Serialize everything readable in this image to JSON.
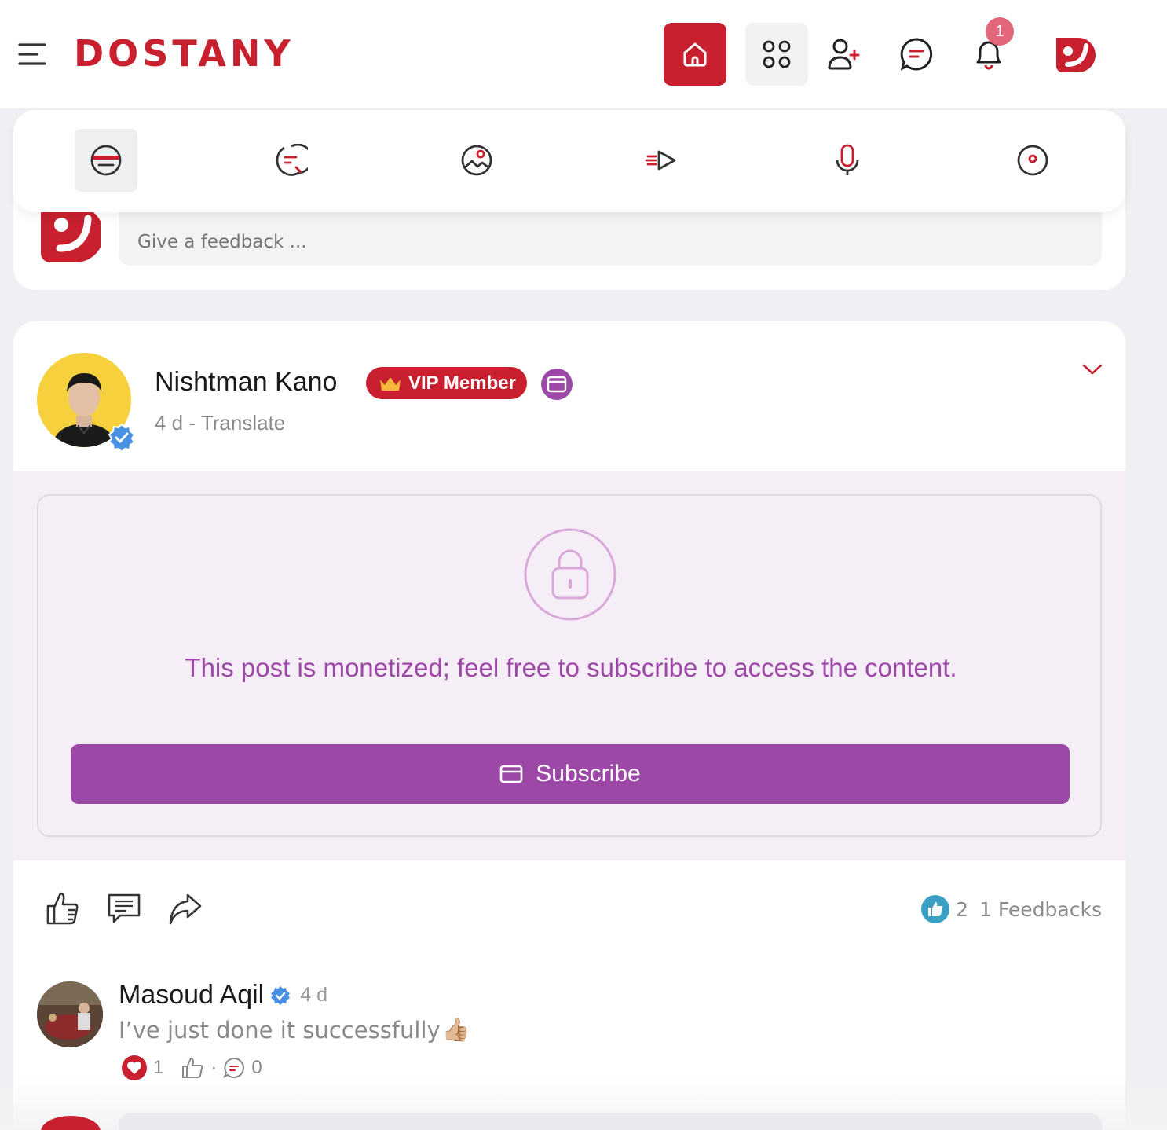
{
  "header": {
    "brand": "DOSTANY",
    "notification_count": "1",
    "colors": {
      "brand_red": "#c8202f",
      "purple": "#9c48a6"
    }
  },
  "composer": {
    "placeholder": "Give a feedback ..."
  },
  "post": {
    "author": "Nishtman Kano",
    "badge": "VIP Member",
    "age": "4 d",
    "separator": "-",
    "translate_label": "Translate",
    "lock_message": "This post is monetized; feel free to subscribe to access the content.",
    "subscribe_label": "Subscribe",
    "likes": "2",
    "feedbacks": "1 Feedbacks"
  },
  "comment": {
    "author": "Masoud Aqil",
    "age": "4 d",
    "text": "I’ve just done it successfully",
    "emoji": "👍🏼",
    "heart_count": "1",
    "dot": "·",
    "reply_count": "0"
  }
}
